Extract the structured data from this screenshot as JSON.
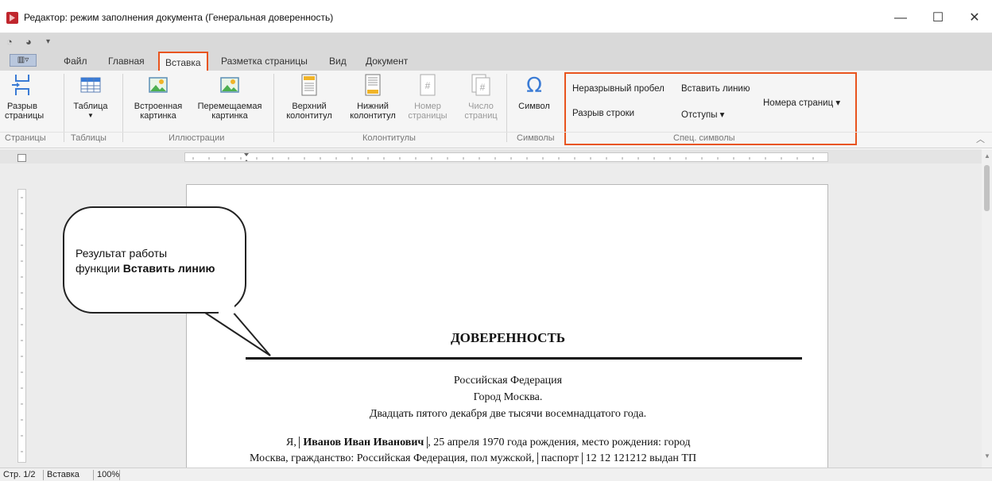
{
  "window": {
    "title": "Редактор: режим заполнения документа (Генеральная доверенность)",
    "minimize": "—",
    "maximize": "☐",
    "close": "✕",
    "accent": "#e8541e"
  },
  "tabs": {
    "file": "Файл",
    "home": "Главная",
    "insert": "Вставка",
    "layout": "Разметка страницы",
    "view": "Вид",
    "document": "Документ"
  },
  "ribbon": {
    "page_break_1": "Разрыв",
    "page_break_2": "страницы",
    "table": "Таблица",
    "builtin_pic_1": "Встроенная",
    "builtin_pic_2": "картинка",
    "float_pic_1": "Перемещаемая",
    "float_pic_2": "картинка",
    "header_1": "Верхний",
    "header_2": "колонтитул",
    "footer_1": "Нижний",
    "footer_2": "колонтитул",
    "page_num_1": "Номер",
    "page_num_2": "страницы",
    "page_count_1": "Число",
    "page_count_2": "страниц",
    "symbol": "Символ",
    "nbsp": "Неразрывный пробел",
    "insert_line": "Вставить линию",
    "page_numbers": "Номера страниц ▾",
    "line_break": "Разрыв строки",
    "indents": "Отступы ▾",
    "groups": {
      "pages": "Страницы",
      "tables": "Таблицы",
      "illustrations": "Иллюстрации",
      "headers": "Колонтитулы",
      "symbols": "Символы",
      "special": "Спец. символы"
    }
  },
  "document": {
    "title": "ДОВЕРЕННОСТЬ",
    "line1": "Российская Федерация",
    "line2": "Город Москва.",
    "line3": "Двадцать пятого декабря две тысячи восемнадцатого года.",
    "para_start": "Я, ",
    "para_name": "Иванов Иван Иванович",
    "para_rest": ", 25 апреля 1970 года рождения, место рождения: город",
    "para_line2_a": "Москва, гражданство: Российская Федерация, пол мужской, ",
    "para_passport": "паспорт",
    "para_line2_b": " 12 12 121212 выдан ТП"
  },
  "callout": {
    "line1": "Результат работы",
    "line2_prefix": "функции ",
    "line2_bold": "Вставить линию"
  },
  "status": {
    "page": "Стр. 1/2",
    "mode": "Вставка",
    "zoom": "100%"
  }
}
